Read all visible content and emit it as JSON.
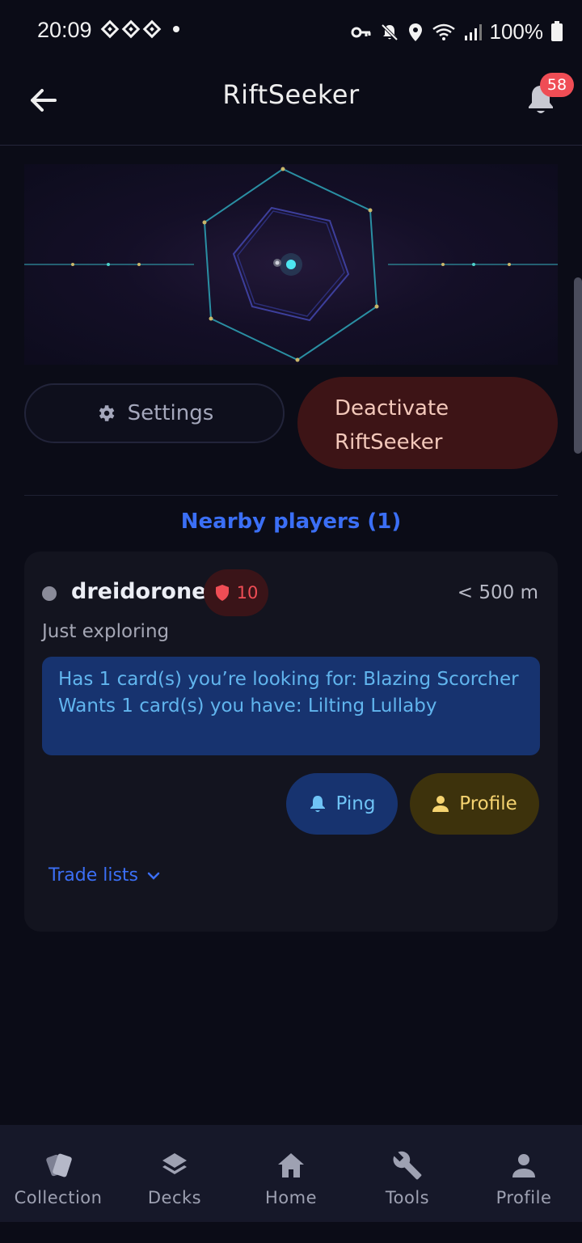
{
  "status_bar": {
    "time": "20:09",
    "battery": "100%",
    "icons": [
      "key-icon",
      "mute-icon",
      "location-icon",
      "wifi-icon",
      "signal-icon",
      "battery-icon"
    ]
  },
  "app_bar": {
    "title": "RiftSeeker",
    "notification_count": "58"
  },
  "actions": {
    "settings_label": "Settings",
    "deactivate_label": "Deactivate\nRiftSeeker"
  },
  "nearby": {
    "title": "Nearby players (1)",
    "players": [
      {
        "name": "dreidorone",
        "rating": "10",
        "distance": "< 500 m",
        "status": "Just exploring",
        "match_has": "Has 1 card(s) you’re looking for: Blazing Scorcher",
        "match_wants": "Wants 1 card(s) you have: Lilting Lullaby",
        "ping_label": "Ping",
        "profile_label": "Profile",
        "trade_lists_label": "Trade lists"
      }
    ]
  },
  "bottom_nav": {
    "items": [
      {
        "label": "Collection",
        "icon": "cards-icon"
      },
      {
        "label": "Decks",
        "icon": "layers-icon"
      },
      {
        "label": "Home",
        "icon": "home-icon"
      },
      {
        "label": "Tools",
        "icon": "wrench-icon"
      },
      {
        "label": "Profile",
        "icon": "person-icon"
      }
    ]
  },
  "colors": {
    "background": "#0b0c17",
    "accent_blue": "#3b6ff5",
    "danger": "#ef4d55",
    "deactivate_bg": "#3d1416",
    "profile_gold": "#f5d370"
  }
}
